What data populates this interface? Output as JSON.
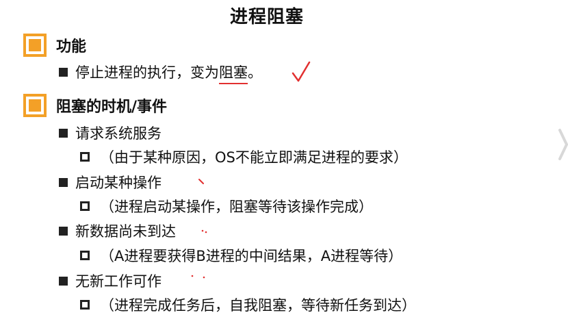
{
  "title": "进程阻塞",
  "sections": [
    {
      "label": "功能",
      "function_item": {
        "before": "停止进程的执行，变为",
        "marked": "阻塞",
        "after": "。"
      }
    },
    {
      "label": "阻塞的时机/事件",
      "items": [
        {
          "text": "请求系统服务",
          "sub": "（由于某种原因，OS不能立即满足进程的要求）"
        },
        {
          "text": "启动某种操作",
          "sub": "（进程启动某操作，阻塞等待该操作完成）"
        },
        {
          "text": "新数据尚未到达",
          "sub": "（A进程要获得B进程的中间结果，A进程等待）"
        },
        {
          "text": "无新工作可作",
          "sub": "（进程完成任务后，自我阻塞，等待新任务到达）"
        }
      ]
    }
  ],
  "colors": {
    "section_icon": "#f3a027",
    "annotation": "#e23030",
    "text": "#111111"
  },
  "icons": {
    "section_marker": "orange-square-icon",
    "level1_bullet": "filled-square-bullet-icon",
    "level2_bullet": "hollow-square-bullet-icon"
  }
}
